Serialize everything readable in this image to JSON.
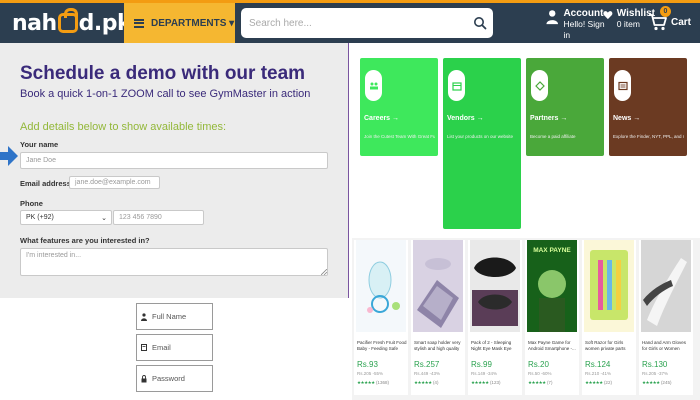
{
  "header": {
    "logo_text_left": "nah",
    "logo_text_right": "d.pk",
    "departments_label": "DEPARTMENTS ▾",
    "search_placeholder": "Search here...",
    "account_title": "Account",
    "account_sub": "Hello! Sign in",
    "wishlist_title": "Wishlist",
    "wishlist_sub": "0 item",
    "cart_label": "Cart",
    "cart_count": "0",
    "accent_color": "#f39c12",
    "bar_color": "#2c3e50"
  },
  "demo": {
    "title": "Schedule a demo with our team",
    "subtitle": "Book a quick 1-on-1 ZOOM call to see GymMaster in action",
    "add_details": "Add details below to show available times:",
    "name_label": "Your name",
    "name_placeholder": "Jane Doe",
    "email_label": "Email address",
    "email_placeholder": "jane.doe@example.com",
    "phone_label": "Phone",
    "country_code": "PK (+92)",
    "phone_placeholder": "123 456 7890",
    "features_label": "What features are you interested in?",
    "features_placeholder": "I'm interested in..."
  },
  "login": {
    "fullname": "Full Name",
    "email": "Email",
    "password": "Password"
  },
  "tiles": [
    {
      "title": "Careers →",
      "desc": "Join the Cutest Team With Great Future",
      "color": "#3ee85c"
    },
    {
      "title": "Vendors →",
      "desc": "List your products on our website",
      "color": "#2bd14b"
    },
    {
      "title": "Partners →",
      "desc": "Become a paid affiliate",
      "color": "#4aa83a"
    },
    {
      "title": "News →",
      "desc": "Explore the Finder, NYT, PPL, and more",
      "color": "#6b3a22"
    }
  ],
  "products": [
    {
      "name": "Pacifier Fresh Fruit Food Baby - Feeding Safe Fruit...",
      "price": "Rs.93",
      "old": "Rs.205 -55%",
      "rating": "(1368)"
    },
    {
      "name": "Smart soap holder very stylish and high quality hea...",
      "price": "Rs.257",
      "old": "Rs.449 -43%",
      "rating": "(4)"
    },
    {
      "name": "Pack of 2 - Sleeping Night Eye Mask Eye Shade Cove...",
      "price": "Rs.99",
      "old": "Rs.149 -34%",
      "rating": "(123)"
    },
    {
      "name": "Max Payne Game for Android Smartphone -...",
      "price": "Rs.20",
      "old": "Rs.50 -60%",
      "rating": "(7)"
    },
    {
      "name": "Soft Razor for Girls women private parts pack of 6",
      "price": "Rs.124",
      "old": "Rs.210 -41%",
      "rating": "(22)"
    },
    {
      "name": "Hand and Arm Gloves for Girls or Women (Muslim...",
      "price": "Rs.130",
      "old": "Rs.205 -37%",
      "rating": "(245)"
    }
  ],
  "product_banner_text": "MAX PAYNE",
  "star_glyphs": "★★★★★"
}
